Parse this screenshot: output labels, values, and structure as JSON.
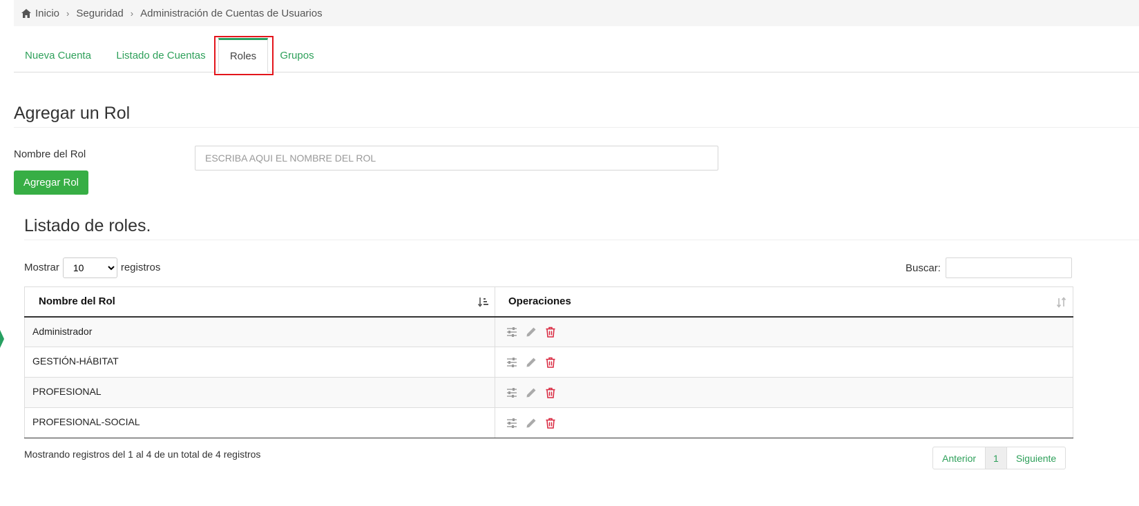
{
  "breadcrumb": {
    "items": [
      "Inicio",
      "Seguridad",
      "Administración de Cuentas de Usuarios"
    ],
    "home_icon": "home-icon"
  },
  "tabs": [
    {
      "label": "Nueva Cuenta",
      "active": false
    },
    {
      "label": "Listado de Cuentas",
      "active": false
    },
    {
      "label": "Roles",
      "active": true
    },
    {
      "label": "Grupos",
      "active": false
    }
  ],
  "form": {
    "title": "Agregar un Rol",
    "label": "Nombre del Rol",
    "placeholder": "ESCRIBA AQUI EL NOMBRE DEL ROL",
    "value": "",
    "submit_label": "Agregar Rol"
  },
  "list": {
    "title": "Listado de roles.",
    "show_label": "Mostrar",
    "show_value": "10",
    "show_options": [
      "10"
    ],
    "records_label": "registros",
    "search_label": "Buscar:",
    "search_value": "",
    "columns": [
      "Nombre del Rol",
      "Operaciones"
    ],
    "rows": [
      {
        "name": "Administrador"
      },
      {
        "name": "GESTIÓN-HÁBITAT"
      },
      {
        "name": "PROFESIONAL"
      },
      {
        "name": "PROFESIONAL-SOCIAL"
      }
    ],
    "row_operations": [
      "sliders-icon",
      "pencil-icon",
      "trash-icon"
    ],
    "info": "Mostrando registros del 1 al 4 de un total de 4 registros",
    "pagination": {
      "prev": "Anterior",
      "page": "1",
      "next": "Siguiente"
    }
  },
  "colors": {
    "accent": "#2ea05a",
    "button": "#37ae45",
    "active_tab_bar": "#27a061",
    "highlight": "#e3141b",
    "trash": "#d9263e"
  }
}
